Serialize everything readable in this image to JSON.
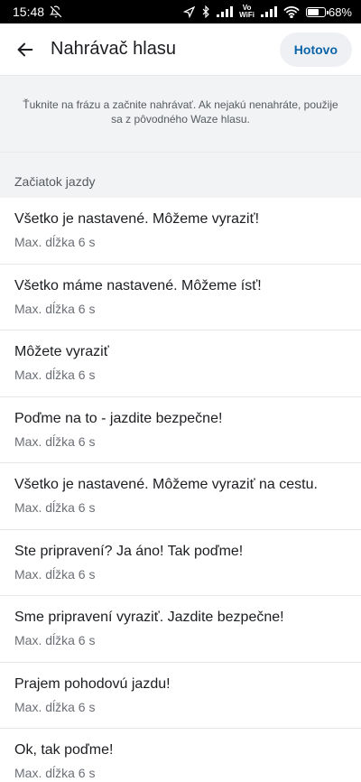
{
  "status_bar": {
    "time": "15:48",
    "vowifi_top": "Vo",
    "vowifi_bottom": "WiFi",
    "battery": "68%",
    "battery_level": 68,
    "icons": [
      "mute-icon",
      "location-icon",
      "bluetooth-icon",
      "signal-icon",
      "wifi-icon",
      "battery-icon"
    ]
  },
  "app_bar": {
    "back_icon": "arrow-left-icon",
    "title": "Nahrávač hlasu",
    "done_label": "Hotovo"
  },
  "info": {
    "text": "Ťuknite na frázu a začnite nahrávať. Ak nejakú nenahráte, použije sa z pôvodného Waze hlasu."
  },
  "section": {
    "title": "Začiatok jazdy"
  },
  "phrases": [
    {
      "title": "Všetko je nastavené. Môžeme vyraziť!",
      "subtitle": "Max. dĺžka 6 s"
    },
    {
      "title": "Všetko máme nastavené. Môžeme ísť!",
      "subtitle": "Max. dĺžka 6 s"
    },
    {
      "title": "Môžete vyraziť",
      "subtitle": "Max. dĺžka 6 s"
    },
    {
      "title": "Poďme na to - jazdite bezpečne!",
      "subtitle": "Max. dĺžka 6 s"
    },
    {
      "title": "Všetko je nastavené. Môžeme vyraziť na cestu.",
      "subtitle": "Max. dĺžka 6 s"
    },
    {
      "title": "Ste pripravení? Ja áno! Tak poďme!",
      "subtitle": "Max. dĺžka 6 s"
    },
    {
      "title": "Sme pripravení vyraziť. Jazdite bezpečne!",
      "subtitle": "Max. dĺžka 6 s"
    },
    {
      "title": "Prajem pohodovú jazdu!",
      "subtitle": "Max. dĺžka 6 s"
    },
    {
      "title": "Ok, tak poďme!",
      "subtitle": "Max. dĺžka 6 s"
    }
  ],
  "colors": {
    "accent": "#0c64a8",
    "panel_bg": "#f2f3f5",
    "divider": "#e6e7ea"
  }
}
